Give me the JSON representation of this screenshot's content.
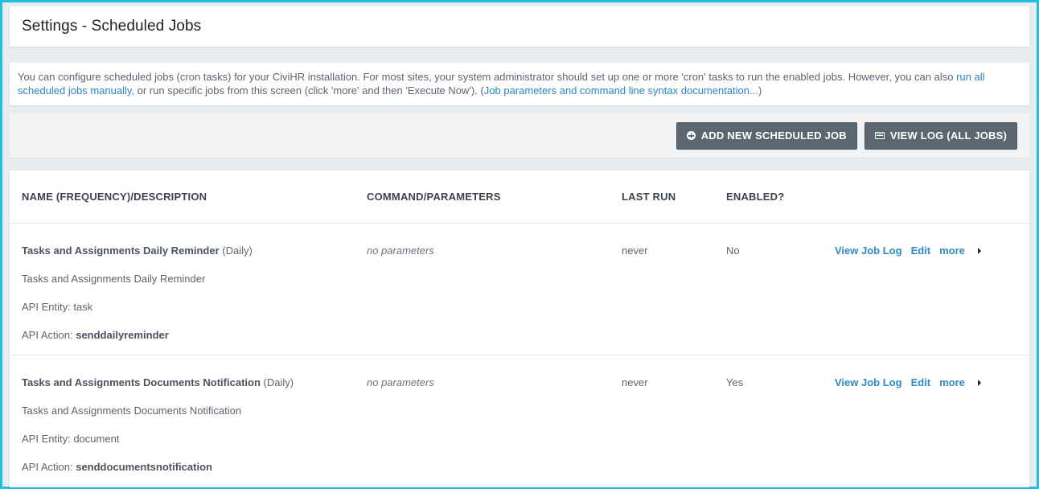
{
  "page": {
    "title": "Settings - Scheduled Jobs"
  },
  "intro": {
    "text1": "You can configure scheduled jobs (cron tasks) for your CiviHR installation. For most sites, your system administrator should set up one or more 'cron' tasks to run the enabled jobs. However, you can also ",
    "link1": "run all scheduled jobs manually",
    "text2": ", or run specific jobs from this screen (click 'more' and then 'Execute Now'). (",
    "link2": "Job parameters and command line syntax documentation...",
    "text3": ")"
  },
  "toolbar": {
    "add_label": "ADD NEW SCHEDULED JOB",
    "log_label": "VIEW LOG (ALL JOBS)"
  },
  "table": {
    "headers": [
      "NAME (FREQUENCY)/DESCRIPTION",
      "COMMAND/PARAMETERS",
      "LAST RUN",
      "ENABLED?"
    ],
    "rows": [
      {
        "name": "Tasks and Assignments Daily Reminder",
        "frequency": "(Daily)",
        "description": "Tasks and Assignments Daily Reminder",
        "entity_label": "API Entity:",
        "entity": "task",
        "action_label": "API Action:",
        "action": "senddailyreminder",
        "params": "no parameters",
        "last_run": "never",
        "enabled": "No",
        "view_log": "View Job Log",
        "edit": "Edit",
        "more": "more"
      },
      {
        "name": "Tasks and Assignments Documents Notification",
        "frequency": "(Daily)",
        "description": "Tasks and Assignments Documents Notification",
        "entity_label": "API Entity:",
        "entity": "document",
        "action_label": "API Action:",
        "action": "senddocumentsnotification",
        "params": "no parameters",
        "last_run": "never",
        "enabled": "Yes",
        "view_log": "View Job Log",
        "edit": "Edit",
        "more": "more"
      }
    ]
  },
  "icons": {
    "add": "plus-circle-icon",
    "log": "list-icon",
    "more": "caret-right-icon"
  },
  "colors": {
    "border": "#1ec0e0",
    "link": "#2786c2",
    "button": "#5b6670"
  }
}
